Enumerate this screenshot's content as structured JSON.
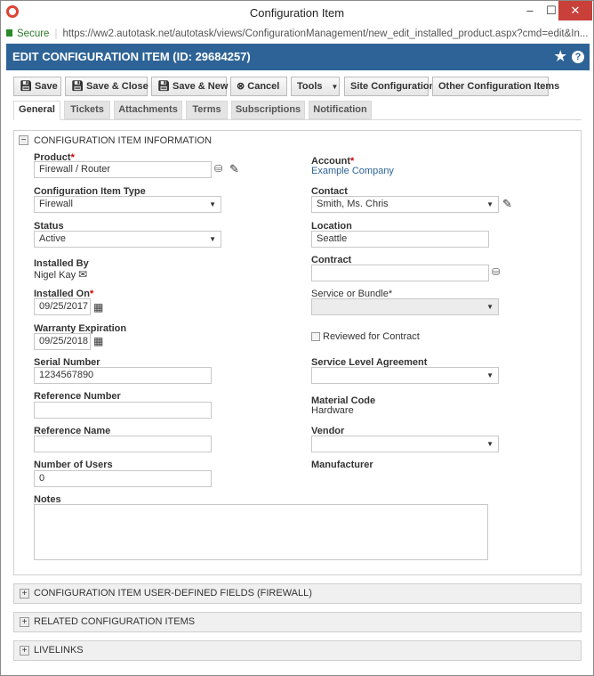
{
  "window": {
    "title": "Configuration Item",
    "minimize": "–",
    "maximize": "☐",
    "close": "✕"
  },
  "address": {
    "secure": "Secure",
    "url": "https://ww2.autotask.net/autotask/views/ConfigurationManagement/new_edit_installed_product.aspx?cmd=edit&In..."
  },
  "header": {
    "title": "EDIT CONFIGURATION ITEM (ID: 29684257)"
  },
  "toolbar": {
    "save": "Save",
    "save_close": "Save & Close",
    "save_new": "Save & New",
    "cancel": "Cancel",
    "tools": "Tools",
    "site_config": "Site Configuration",
    "other_items": "Other Configuration Items"
  },
  "tabs": [
    "General",
    "Tickets",
    "Attachments",
    "Terms",
    "Subscriptions",
    "Notification"
  ],
  "section": {
    "title": "CONFIGURATION ITEM INFORMATION"
  },
  "fields": {
    "product": {
      "label": "Product",
      "value": "Firewall / Router"
    },
    "ci_type": {
      "label": "Configuration Item Type",
      "value": "Firewall"
    },
    "status": {
      "label": "Status",
      "value": "Active"
    },
    "installed_by": {
      "label": "Installed By",
      "value": "Nigel Kay"
    },
    "installed_on": {
      "label": "Installed On",
      "value": "09/25/2017"
    },
    "warranty": {
      "label": "Warranty Expiration",
      "value": "09/25/2018"
    },
    "serial": {
      "label": "Serial Number",
      "value": "1234567890"
    },
    "ref_number": {
      "label": "Reference Number",
      "value": ""
    },
    "ref_name": {
      "label": "Reference Name",
      "value": ""
    },
    "num_users": {
      "label": "Number of Users",
      "value": "0"
    },
    "notes": {
      "label": "Notes",
      "value": ""
    },
    "account": {
      "label": "Account",
      "value": "Example Company"
    },
    "contact": {
      "label": "Contact",
      "value": "Smith, Ms. Chris"
    },
    "location": {
      "label": "Location",
      "value": "Seattle"
    },
    "contract": {
      "label": "Contract",
      "value": ""
    },
    "service": {
      "label": "Service or Bundle",
      "value": ""
    },
    "reviewed": {
      "label": "Reviewed for Contract",
      "checked": false
    },
    "sla": {
      "label": "Service Level Agreement",
      "value": ""
    },
    "material": {
      "label": "Material Code",
      "value": "Hardware"
    },
    "vendor": {
      "label": "Vendor",
      "value": ""
    },
    "manufacturer": {
      "label": "Manufacturer"
    }
  },
  "collapsed_sections": [
    "CONFIGURATION ITEM USER-DEFINED FIELDS (FIREWALL)",
    "RELATED CONFIGURATION ITEMS",
    "LIVELINKS"
  ],
  "required_mark": "*"
}
